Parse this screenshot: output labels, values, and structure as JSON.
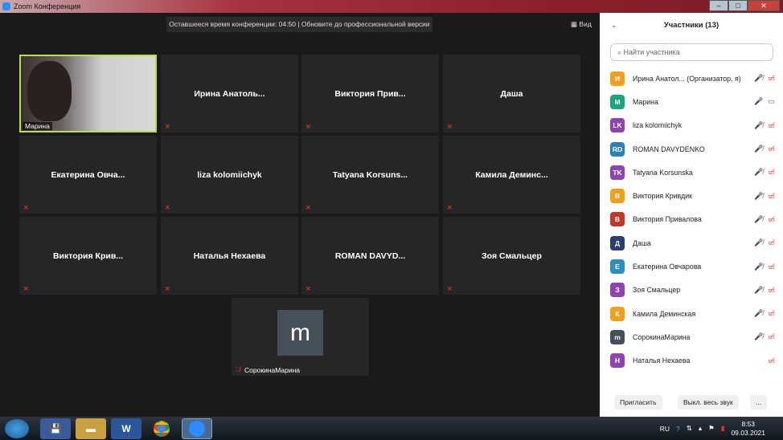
{
  "window": {
    "title": "Zoom Конференция",
    "minimize": "–",
    "maximize": "□",
    "close": "✕"
  },
  "banner": "Оставшееся время конференции: 04:50 | Обновите до профессиональной версии",
  "view_label": "Вид",
  "tiles": [
    {
      "name": "Марина",
      "active": true
    },
    {
      "name": "Ирина  Анатоль..."
    },
    {
      "name": "Виктория  Прив..."
    },
    {
      "name": "Даша"
    },
    {
      "name": "Екатерина  Овча..."
    },
    {
      "name": "liza kolomiichyk"
    },
    {
      "name": "Tatyana  Korsuns..."
    },
    {
      "name": "Камила  Деминс..."
    },
    {
      "name": "Виктория  Крив..."
    },
    {
      "name": "Наталья Нехаева"
    },
    {
      "name": "ROMAN  DAVYD..."
    },
    {
      "name": "Зоя Смальцер"
    },
    {
      "name": "СорокинаМарина",
      "avatar_letter": "m"
    }
  ],
  "panel": {
    "title": "Участники (13)",
    "search_placeholder": "Найти участника",
    "participants": [
      {
        "initials": "И",
        "name": "Ирина Анатол...  (Организатор, я)",
        "color": "#f0a020",
        "muted": true,
        "video_off": true
      },
      {
        "initials": "М",
        "name": "Марина",
        "color": "#1aa57a",
        "muted": false,
        "video_off": false
      },
      {
        "initials": "LK",
        "name": "liza kolomiichyk",
        "color": "#8e44ad",
        "muted": true,
        "video_off": true
      },
      {
        "initials": "RD",
        "name": "ROMAN DAVYDENKO",
        "color": "#2d7fb8",
        "muted": true,
        "video_off": true
      },
      {
        "initials": "TK",
        "name": "Tatyana Korsunska",
        "color": "#8e44ad",
        "muted": true,
        "video_off": true
      },
      {
        "initials": "В",
        "name": "Виктория Кривдик",
        "color": "#f0a020",
        "muted": true,
        "video_off": true
      },
      {
        "initials": "В",
        "name": "Виктория Привалова",
        "color": "#c0392b",
        "muted": true,
        "video_off": true
      },
      {
        "initials": "Д",
        "name": "Даша",
        "color": "#2c3e6b",
        "muted": true,
        "video_off": true
      },
      {
        "initials": "Е",
        "name": "Екатерина Овчарова",
        "color": "#2d8fbf",
        "muted": true,
        "video_off": true
      },
      {
        "initials": "З",
        "name": "Зоя Смальцер",
        "color": "#8e44ad",
        "muted": true,
        "video_off": true
      },
      {
        "initials": "К",
        "name": "Камила Деминская",
        "color": "#f0a020",
        "muted": true,
        "video_off": true
      },
      {
        "initials": "m",
        "name": "СорокинаМарина",
        "color": "#45505a",
        "muted": true,
        "video_off": true
      },
      {
        "initials": "Н",
        "name": "Наталья Нехаева",
        "color": "#8e44ad",
        "muted": null,
        "video_off": true
      }
    ],
    "invite": "Пригласить",
    "mute_all": "Выкл. весь звук",
    "more": "..."
  },
  "taskbar": {
    "lang": "RU",
    "time": "8:53",
    "date": "09.03.2021"
  }
}
